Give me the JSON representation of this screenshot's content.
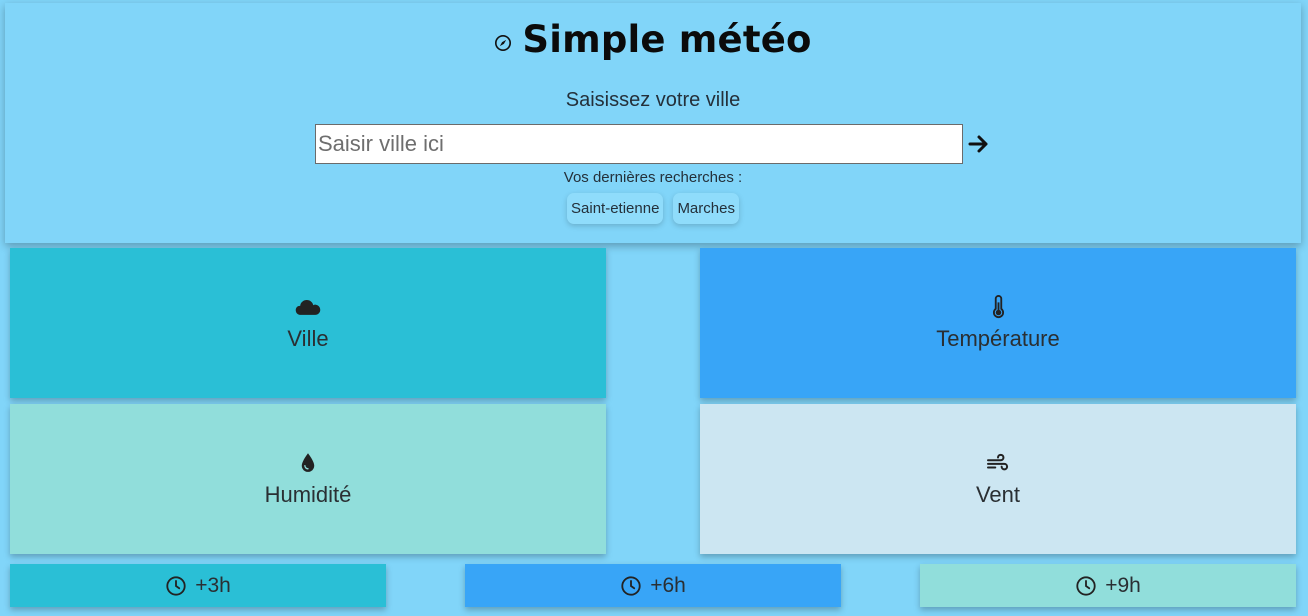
{
  "header": {
    "title": "Simple météo",
    "prompt": "Saisissez votre ville",
    "recent_label": "Vos dernières recherches :"
  },
  "search": {
    "placeholder": "Saisir ville ici",
    "value": ""
  },
  "recent_searches": [
    "Saint-etienne",
    "Marches"
  ],
  "cards": {
    "city": {
      "label": "Ville",
      "icon": "cloud-icon",
      "color": "#2abfd6"
    },
    "temperature": {
      "label": "Température",
      "icon": "thermometer-icon",
      "color": "#38a5f7"
    },
    "humidity": {
      "label": "Humidité",
      "icon": "droplet-icon",
      "color": "#91dedb"
    },
    "wind": {
      "label": "Vent",
      "icon": "wind-icon",
      "color": "#cce6f2"
    }
  },
  "forecast": [
    {
      "label": "+3h",
      "icon": "clock-icon",
      "color": "#2abfd6"
    },
    {
      "label": "+6h",
      "icon": "clock-icon",
      "color": "#38a5f7"
    },
    {
      "label": "+9h",
      "icon": "clock-icon",
      "color": "#91dedb"
    }
  ],
  "colors": {
    "background": "#81d5f9"
  }
}
